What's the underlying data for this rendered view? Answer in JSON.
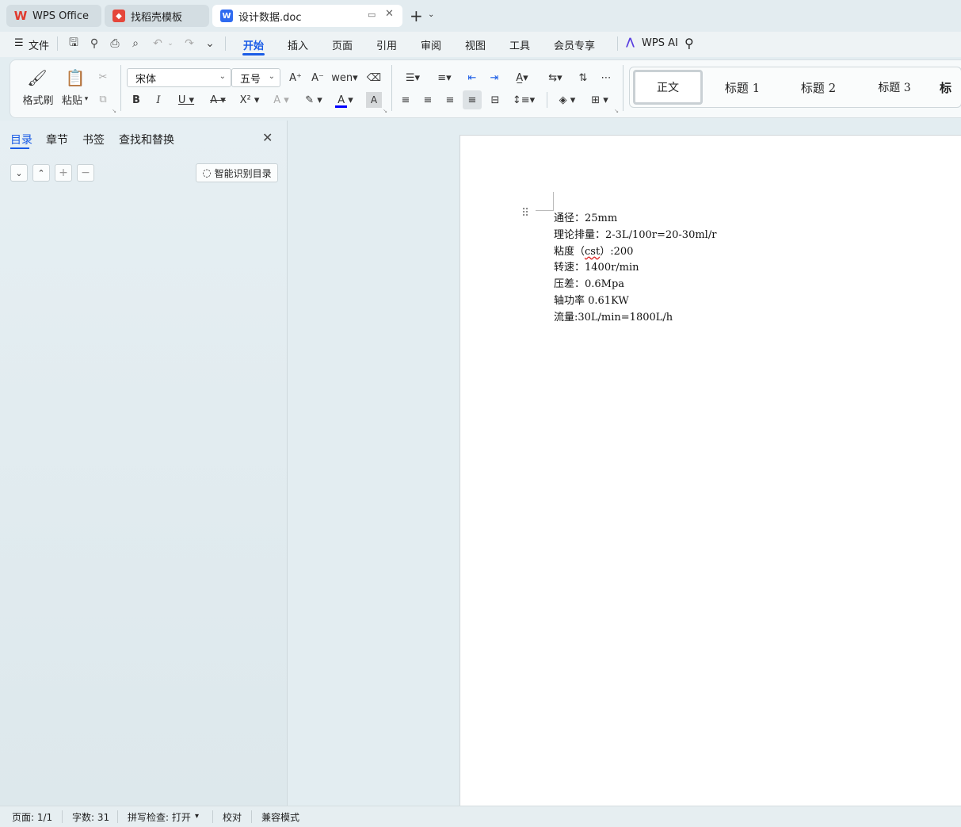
{
  "tabs": [
    {
      "label": "WPS Office",
      "icon": "wps-logo-icon"
    },
    {
      "label": "找稻壳模板",
      "icon": "docer-icon"
    },
    {
      "label": "设计数据.doc",
      "icon": "word-doc-icon"
    }
  ],
  "menu": {
    "file_label": "文件",
    "items": [
      "开始",
      "插入",
      "页面",
      "引用",
      "审阅",
      "视图",
      "工具",
      "会员专享"
    ],
    "ai_label": "WPS AI"
  },
  "ribbon": {
    "format_painter": "格式刷",
    "paste": "粘贴",
    "font_name": "宋体",
    "font_size": "五号",
    "styles": [
      "正文",
      "标题  1",
      "标题  2",
      "标题  3",
      "标"
    ]
  },
  "nav_panel": {
    "tabs": [
      "目录",
      "章节",
      "书签",
      "查找和替换"
    ],
    "smart_toc_label": "智能识别目录"
  },
  "document": {
    "lines": [
      "通径：25mm",
      "理论排量：2-3L/100r=20-30ml/r",
      "粘度（",
      "cst",
      "）:200",
      "转速：1400r/min",
      "压差：0.6Mpa",
      "轴功率 0.61KW",
      "流量:30L/min=1800L/h"
    ]
  },
  "status": {
    "page": "页面: 1/1",
    "word_count": "字数: 31",
    "spell_check": "拼写检查: 打开",
    "proofread": "校对",
    "compat_mode": "兼容模式"
  },
  "colors": {
    "accent": "#1a5ce6",
    "font_color_bar": "#0000ff",
    "wps_red": "#e03a2e"
  }
}
